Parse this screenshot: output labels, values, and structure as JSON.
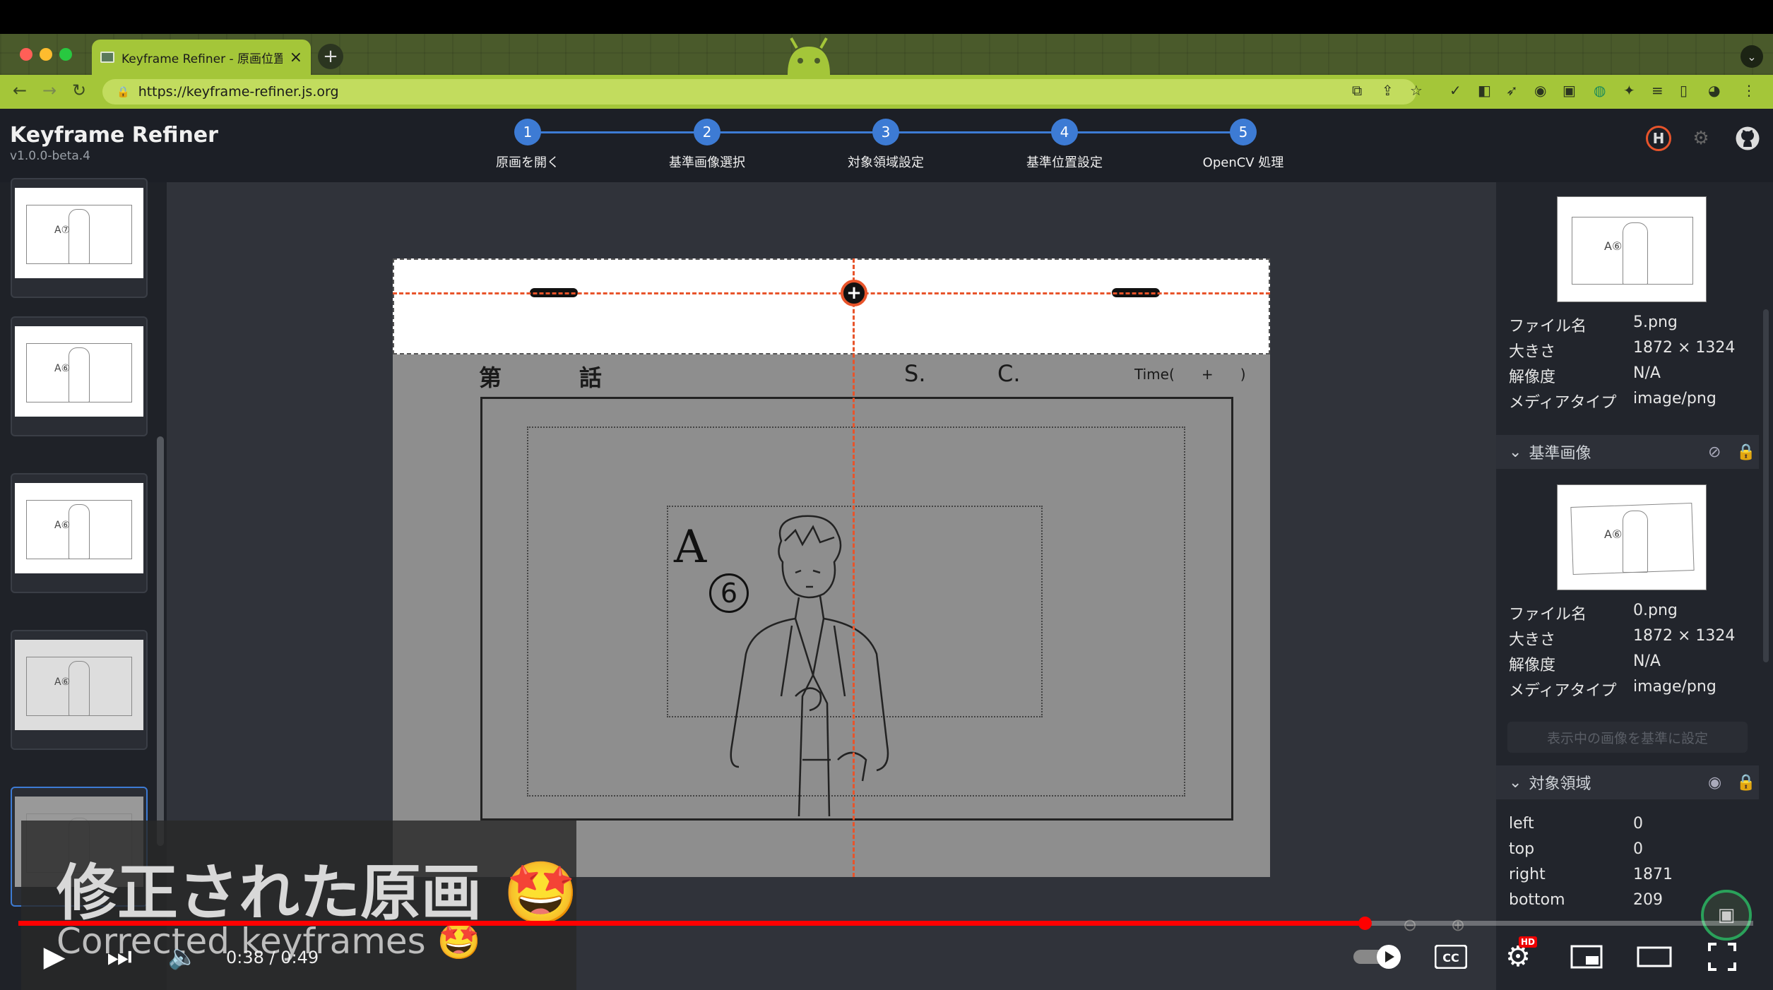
{
  "browser": {
    "tab_title": "Keyframe Refiner - 原画位置合",
    "url": "https://keyframe-refiner.js.org"
  },
  "app": {
    "title": "Keyframe Refiner",
    "version": "v1.0.0-beta.4"
  },
  "steps": [
    {
      "num": "1",
      "label": "原画を開く"
    },
    {
      "num": "2",
      "label": "基準画像選択"
    },
    {
      "num": "3",
      "label": "対象領域設定"
    },
    {
      "num": "4",
      "label": "基準位置設定"
    },
    {
      "num": "5",
      "label": "OpenCV 処理"
    }
  ],
  "sheet": {
    "dai": "第",
    "wa": "話",
    "s": "S.",
    "c": "C.",
    "time": "Time(      +      )",
    "hand_a": "A",
    "hand_6": "6"
  },
  "current_image": {
    "rows": [
      {
        "key": "ファイル名",
        "value": "5.png"
      },
      {
        "key": "大きさ",
        "value": "1872 × 1324"
      },
      {
        "key": "解像度",
        "value": "N/A"
      },
      {
        "key": "メディアタイプ",
        "value": "image/png"
      }
    ]
  },
  "base_image": {
    "section_title": "基準画像",
    "rows": [
      {
        "key": "ファイル名",
        "value": "0.png"
      },
      {
        "key": "大きさ",
        "value": "1872 × 1324"
      },
      {
        "key": "解像度",
        "value": "N/A"
      },
      {
        "key": "メディアタイプ",
        "value": "image/png"
      }
    ],
    "set_button": "表示中の画像を基準に設定"
  },
  "target_area": {
    "section_title": "対象領域",
    "rows": [
      {
        "key": "left",
        "value": "0"
      },
      {
        "key": "top",
        "value": "0"
      },
      {
        "key": "right",
        "value": "1871"
      },
      {
        "key": "bottom",
        "value": "209"
      }
    ]
  },
  "video": {
    "subtitle_ja": "修正された原画 🤩",
    "subtitle_en": "Corrected keyframes 🤩",
    "time": "0:38 / 0:49",
    "progress": 0.776,
    "hd_badge": "HD"
  }
}
